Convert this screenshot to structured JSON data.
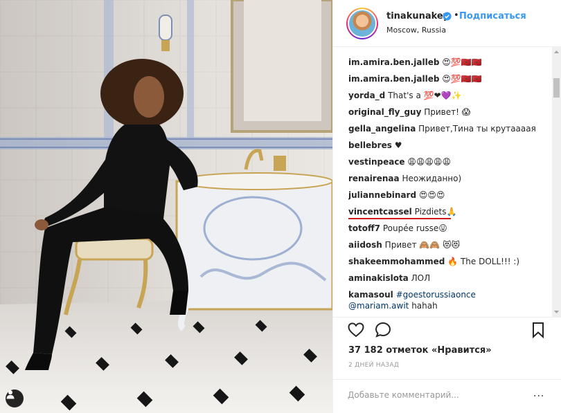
{
  "post": {
    "username": "tinakunakey",
    "verified": true,
    "separator": "•",
    "follow_label": "Подписаться",
    "location": "Moscow, Russia"
  },
  "comments": [
    {
      "user": "im.amira.ben.jalleb",
      "text": "😍💯🇲🇦🇲🇦"
    },
    {
      "user": "im.amira.ben.jalleb",
      "text": "😍💯🇲🇦🇲🇦"
    },
    {
      "user": "yorda_d",
      "text": "That's a 💯❤💜✨"
    },
    {
      "user": "original_fly_guy",
      "text": "Привет! 😱"
    },
    {
      "user": "gella_angelina",
      "text": "Привет,Тина ты крутаааая"
    },
    {
      "user": "bellebres",
      "text": "♥"
    },
    {
      "user": "vestinpeace",
      "text": "😩😩😩😩😩"
    },
    {
      "user": "renairenaa",
      "text": "Неожиданно)"
    },
    {
      "user": "juliannebinard",
      "text": "😍😍😍"
    },
    {
      "user": "vincentcassel",
      "text": "Pizdiets🙏"
    },
    {
      "user": "totoff7",
      "text": "Poupée russe😛"
    },
    {
      "user": "aiidosh",
      "text": "Привет 🙈🙈 😻😻"
    },
    {
      "user": "shakeemmohammed",
      "text": "🔥 The DOLL!!! :)"
    },
    {
      "user": "aminakislota",
      "text": "ЛОЛ"
    },
    {
      "user": "kamasoul",
      "link": "#goestorussiaonce",
      "mention": "@mariam.awit",
      "text": "hahah"
    }
  ],
  "highlight": {
    "color": "#d11a1a",
    "comment_index": 9
  },
  "actions": {
    "like_icon": "heart-icon",
    "comment_icon": "speech-bubble-icon",
    "save_icon": "bookmark-icon"
  },
  "likes_text": "37 182 отметок «Нравится»",
  "timestamp": "2 ДНЕЙ НАЗАД",
  "add_comment": {
    "placeholder": "Добавьте комментарий...",
    "more_label": "..."
  },
  "colors": {
    "accent": "#3897f0",
    "text": "#262626",
    "muted": "#999999",
    "link": "#003569",
    "border": "#efefef"
  }
}
